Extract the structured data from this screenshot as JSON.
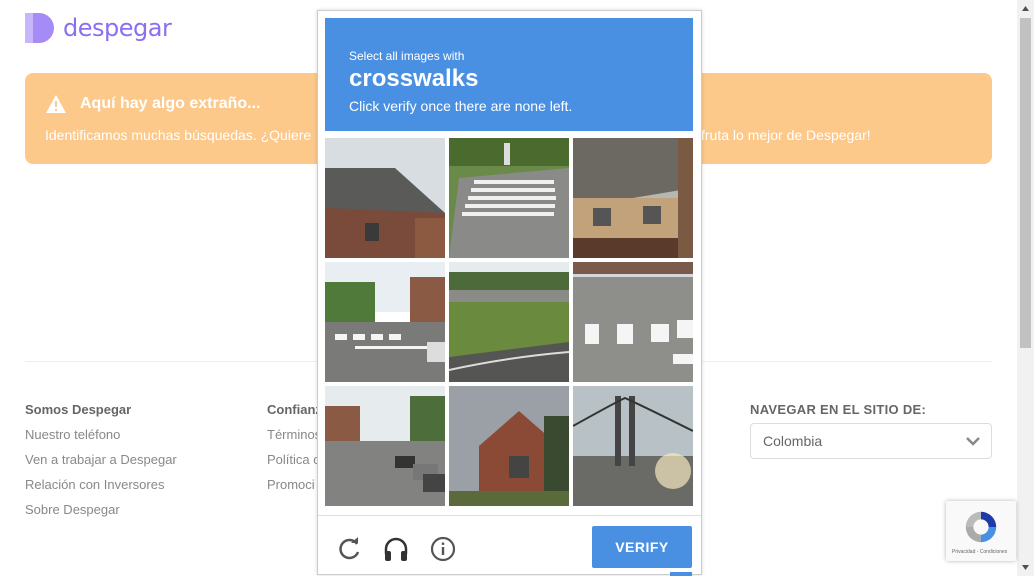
{
  "brand": {
    "name": "despegar",
    "color": "#8a6ff0"
  },
  "banner": {
    "title": "Aquí hay algo extraño...",
    "text_left": "Identificamos muchas búsquedas. ¿Quiere",
    "text_right": "fruta lo mejor de Despegar!",
    "color": "#fcc98a"
  },
  "footer": {
    "col1": {
      "title": "Somos Despegar",
      "links": [
        "Nuestro teléfono",
        "Ven a trabajar a Despegar",
        "Relación con Inversores",
        "Sobre Despegar"
      ]
    },
    "col2": {
      "title": "Confianz",
      "links": [
        "Términos",
        "Política c",
        "Promoci"
      ]
    },
    "nav": {
      "title": "NAVEGAR EN EL SITIO DE:",
      "selected": "Colombia"
    }
  },
  "captcha": {
    "instruction": "Select all images with",
    "target": "crosswalks",
    "subtext": "Click verify once there are none left.",
    "verify_label": "VERIFY",
    "accent": "#4a90e2",
    "tiles": [
      {
        "name": "tile-1-house-roof"
      },
      {
        "name": "tile-2-crosswalk-street"
      },
      {
        "name": "tile-3-townhouses"
      },
      {
        "name": "tile-4-street-crosswalk"
      },
      {
        "name": "tile-5-road-grass"
      },
      {
        "name": "tile-6-crosswalk-road"
      },
      {
        "name": "tile-7-street-cars"
      },
      {
        "name": "tile-8-brick-house"
      },
      {
        "name": "tile-9-bridge"
      }
    ]
  },
  "recaptcha_badge": {
    "text": "Privacidad - Condiciones"
  }
}
